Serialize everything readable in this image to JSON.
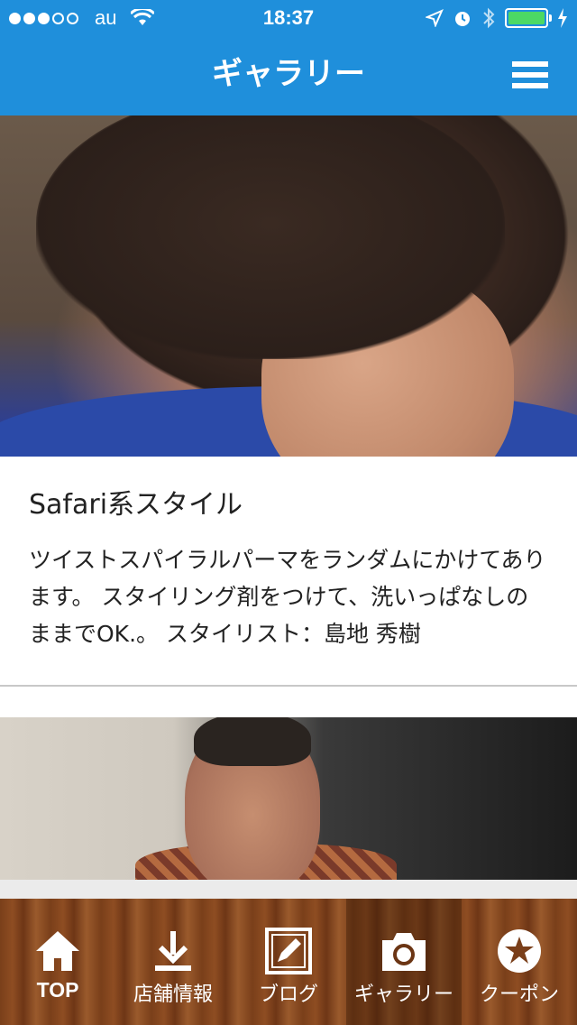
{
  "status_bar": {
    "carrier": "au",
    "time": "18:37",
    "signal_bars_filled": 3,
    "signal_bars_total": 5,
    "battery_level": 1.0
  },
  "nav": {
    "title": "ギャラリー",
    "menu_icon": "hamburger-icon"
  },
  "gallery": {
    "items": [
      {
        "title": "Safari系スタイル",
        "description": "ツイストスパイラルパーマをランダムにかけてあります。 スタイリング剤をつけて、洗いっぱなしのままでOK.。 スタイリスト：島地 秀樹"
      }
    ]
  },
  "tabs": [
    {
      "label": "TOP",
      "icon": "home-icon",
      "active": false
    },
    {
      "label": "店舗情報",
      "icon": "download-icon",
      "active": false
    },
    {
      "label": "ブログ",
      "icon": "pencil-icon",
      "active": false
    },
    {
      "label": "ギャラリー",
      "icon": "camera-icon",
      "active": true
    },
    {
      "label": "クーポン",
      "icon": "star-icon",
      "active": false
    }
  ],
  "colors": {
    "nav_blue": "#1f8fdb",
    "battery_green": "#4cd964",
    "tab_wood": "#7a3f1a"
  }
}
